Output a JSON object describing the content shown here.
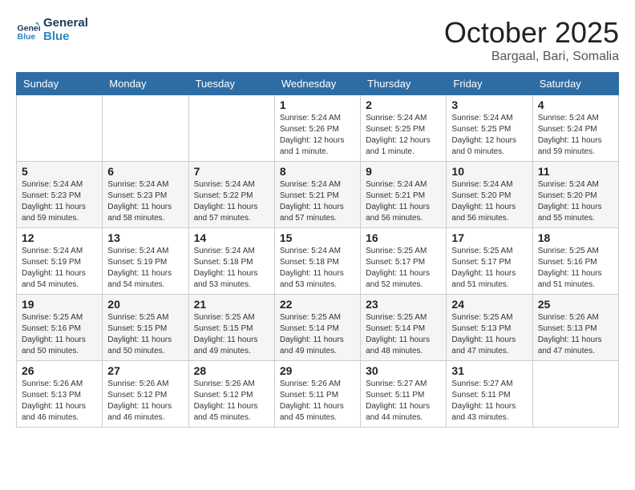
{
  "header": {
    "logo_line1": "General",
    "logo_line2": "Blue",
    "month": "October 2025",
    "location": "Bargaal, Bari, Somalia"
  },
  "weekdays": [
    "Sunday",
    "Monday",
    "Tuesday",
    "Wednesday",
    "Thursday",
    "Friday",
    "Saturday"
  ],
  "weeks": [
    [
      {
        "day": "",
        "info": ""
      },
      {
        "day": "",
        "info": ""
      },
      {
        "day": "",
        "info": ""
      },
      {
        "day": "1",
        "info": "Sunrise: 5:24 AM\nSunset: 5:26 PM\nDaylight: 12 hours\nand 1 minute."
      },
      {
        "day": "2",
        "info": "Sunrise: 5:24 AM\nSunset: 5:25 PM\nDaylight: 12 hours\nand 1 minute."
      },
      {
        "day": "3",
        "info": "Sunrise: 5:24 AM\nSunset: 5:25 PM\nDaylight: 12 hours\nand 0 minutes."
      },
      {
        "day": "4",
        "info": "Sunrise: 5:24 AM\nSunset: 5:24 PM\nDaylight: 11 hours\nand 59 minutes."
      }
    ],
    [
      {
        "day": "5",
        "info": "Sunrise: 5:24 AM\nSunset: 5:23 PM\nDaylight: 11 hours\nand 59 minutes."
      },
      {
        "day": "6",
        "info": "Sunrise: 5:24 AM\nSunset: 5:23 PM\nDaylight: 11 hours\nand 58 minutes."
      },
      {
        "day": "7",
        "info": "Sunrise: 5:24 AM\nSunset: 5:22 PM\nDaylight: 11 hours\nand 57 minutes."
      },
      {
        "day": "8",
        "info": "Sunrise: 5:24 AM\nSunset: 5:21 PM\nDaylight: 11 hours\nand 57 minutes."
      },
      {
        "day": "9",
        "info": "Sunrise: 5:24 AM\nSunset: 5:21 PM\nDaylight: 11 hours\nand 56 minutes."
      },
      {
        "day": "10",
        "info": "Sunrise: 5:24 AM\nSunset: 5:20 PM\nDaylight: 11 hours\nand 56 minutes."
      },
      {
        "day": "11",
        "info": "Sunrise: 5:24 AM\nSunset: 5:20 PM\nDaylight: 11 hours\nand 55 minutes."
      }
    ],
    [
      {
        "day": "12",
        "info": "Sunrise: 5:24 AM\nSunset: 5:19 PM\nDaylight: 11 hours\nand 54 minutes."
      },
      {
        "day": "13",
        "info": "Sunrise: 5:24 AM\nSunset: 5:19 PM\nDaylight: 11 hours\nand 54 minutes."
      },
      {
        "day": "14",
        "info": "Sunrise: 5:24 AM\nSunset: 5:18 PM\nDaylight: 11 hours\nand 53 minutes."
      },
      {
        "day": "15",
        "info": "Sunrise: 5:24 AM\nSunset: 5:18 PM\nDaylight: 11 hours\nand 53 minutes."
      },
      {
        "day": "16",
        "info": "Sunrise: 5:25 AM\nSunset: 5:17 PM\nDaylight: 11 hours\nand 52 minutes."
      },
      {
        "day": "17",
        "info": "Sunrise: 5:25 AM\nSunset: 5:17 PM\nDaylight: 11 hours\nand 51 minutes."
      },
      {
        "day": "18",
        "info": "Sunrise: 5:25 AM\nSunset: 5:16 PM\nDaylight: 11 hours\nand 51 minutes."
      }
    ],
    [
      {
        "day": "19",
        "info": "Sunrise: 5:25 AM\nSunset: 5:16 PM\nDaylight: 11 hours\nand 50 minutes."
      },
      {
        "day": "20",
        "info": "Sunrise: 5:25 AM\nSunset: 5:15 PM\nDaylight: 11 hours\nand 50 minutes."
      },
      {
        "day": "21",
        "info": "Sunrise: 5:25 AM\nSunset: 5:15 PM\nDaylight: 11 hours\nand 49 minutes."
      },
      {
        "day": "22",
        "info": "Sunrise: 5:25 AM\nSunset: 5:14 PM\nDaylight: 11 hours\nand 49 minutes."
      },
      {
        "day": "23",
        "info": "Sunrise: 5:25 AM\nSunset: 5:14 PM\nDaylight: 11 hours\nand 48 minutes."
      },
      {
        "day": "24",
        "info": "Sunrise: 5:25 AM\nSunset: 5:13 PM\nDaylight: 11 hours\nand 47 minutes."
      },
      {
        "day": "25",
        "info": "Sunrise: 5:26 AM\nSunset: 5:13 PM\nDaylight: 11 hours\nand 47 minutes."
      }
    ],
    [
      {
        "day": "26",
        "info": "Sunrise: 5:26 AM\nSunset: 5:13 PM\nDaylight: 11 hours\nand 46 minutes."
      },
      {
        "day": "27",
        "info": "Sunrise: 5:26 AM\nSunset: 5:12 PM\nDaylight: 11 hours\nand 46 minutes."
      },
      {
        "day": "28",
        "info": "Sunrise: 5:26 AM\nSunset: 5:12 PM\nDaylight: 11 hours\nand 45 minutes."
      },
      {
        "day": "29",
        "info": "Sunrise: 5:26 AM\nSunset: 5:11 PM\nDaylight: 11 hours\nand 45 minutes."
      },
      {
        "day": "30",
        "info": "Sunrise: 5:27 AM\nSunset: 5:11 PM\nDaylight: 11 hours\nand 44 minutes."
      },
      {
        "day": "31",
        "info": "Sunrise: 5:27 AM\nSunset: 5:11 PM\nDaylight: 11 hours\nand 43 minutes."
      },
      {
        "day": "",
        "info": ""
      }
    ]
  ]
}
